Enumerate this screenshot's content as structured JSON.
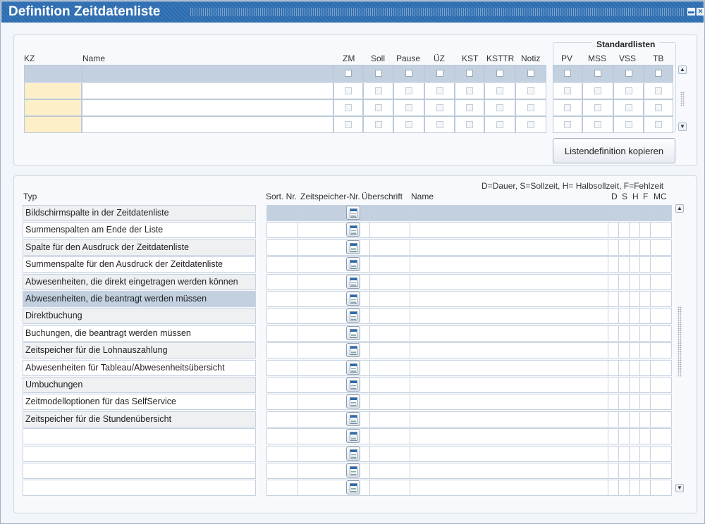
{
  "window": {
    "title": "Definition Zeitdatenliste"
  },
  "top": {
    "headers": {
      "kz": "KZ",
      "name": "Name",
      "zm": "ZM",
      "soll": "Soll",
      "pause": "Pause",
      "ue": "ÜZ",
      "kst": "KST",
      "ksttr": "KSTTR",
      "notiz": "Notiz"
    },
    "standardlisten": {
      "title": "Standardlisten",
      "pv": "PV",
      "mss": "MSS",
      "vss": "VSS",
      "tb": "TB"
    },
    "copy_button": "Listendefinition kopieren"
  },
  "bottom": {
    "legend": "D=Dauer, S=Sollzeit, H= Halbsollzeit, F=Fehlzeit",
    "headers": {
      "typ": "Typ",
      "sort": "Sort. Nr.",
      "zeitspeicher": "Zeitspeicher-Nr.",
      "ueberschrift": "Überschrift",
      "name": "Name",
      "d": "D",
      "s": "S",
      "h": "H",
      "f": "F",
      "mc": "MC"
    },
    "types": [
      "Bildschirmspalte in der Zeitdatenliste",
      "Summenspalten am Ende der Liste",
      "Spalte für den Ausdruck der Zeitdatenliste",
      "Summenspalte für den Ausdruck der Zeitdatenliste",
      "Abwesenheiten, die direkt eingetragen werden können",
      "Abwesenheiten, die beantragt werden müssen",
      "Direktbuchung",
      "Buchungen, die beantragt werden müssen",
      "Zeitspeicher für die Lohnauszahlung",
      "Abwesenheiten für Tableau/Abwesenheitsübersicht",
      "Umbuchungen",
      "Zeitmodelloptionen für das SelfService",
      "Zeitspeicher für die Stundenübersicht",
      "",
      "",
      "",
      ""
    ]
  },
  "colors": {
    "titlebar": "#2a6bb0",
    "selected_row": "#c2d0e0",
    "kz_cell": "#fdf0c8"
  }
}
